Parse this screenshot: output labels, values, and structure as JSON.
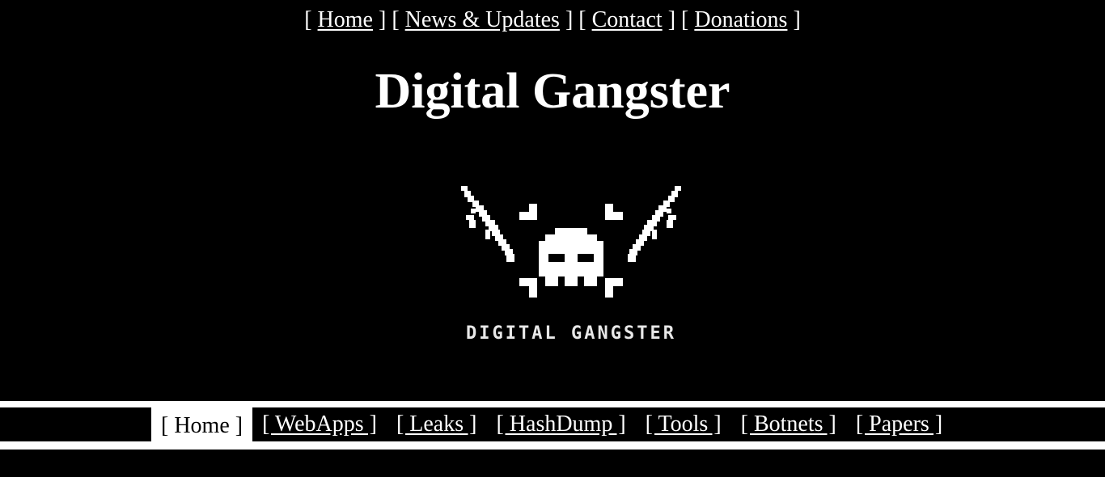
{
  "top_nav": {
    "open_bracket": "[",
    "close_bracket": "]",
    "items": [
      {
        "label": "Home"
      },
      {
        "label": "News & Updates"
      },
      {
        "label": "Contact"
      },
      {
        "label": "Donations"
      }
    ]
  },
  "site_title": "Digital Gangster",
  "logo": {
    "text": "DIGITAL GANGSTER",
    "icon": "skull-with-rifles-icon"
  },
  "menu": {
    "items": [
      {
        "label": "[ Home ]",
        "active": true
      },
      {
        "label": "[ WebApps ]",
        "active": false
      },
      {
        "label": "[ Leaks ]",
        "active": false
      },
      {
        "label": "[ HashDump ]",
        "active": false
      },
      {
        "label": "[ Tools ]",
        "active": false
      },
      {
        "label": "[ Botnets ]",
        "active": false
      },
      {
        "label": "[ Papers ]",
        "active": false
      }
    ]
  },
  "colors": {
    "background": "#000000",
    "foreground": "#ffffff"
  }
}
